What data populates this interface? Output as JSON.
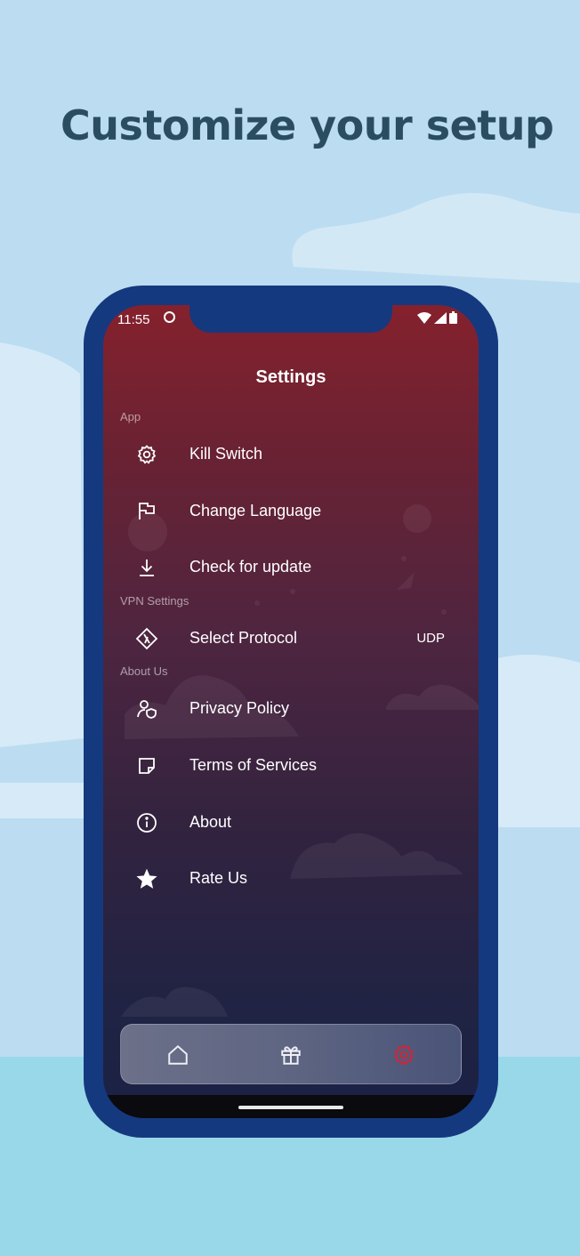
{
  "headline": "Customize your setup",
  "status_bar": {
    "time": "11:55"
  },
  "screen": {
    "title": "Settings",
    "sections": {
      "app": "App",
      "vpn": "VPN Settings",
      "about": "About Us"
    },
    "items": {
      "kill_switch": "Kill Switch",
      "change_language": "Change Language",
      "check_update": "Check for update",
      "select_protocol": "Select Protocol",
      "protocol_value": "UDP",
      "privacy_policy": "Privacy Policy",
      "terms": "Terms of Services",
      "about": "About",
      "rate_us": "Rate Us"
    },
    "icons": {
      "kill_switch": "gear-icon",
      "change_language": "flag-icon",
      "check_update": "download-icon",
      "select_protocol": "protocol-icon",
      "privacy_policy": "user-shield-icon",
      "terms": "note-icon",
      "about": "info-icon",
      "rate_us": "star-icon"
    }
  },
  "bottom_nav": {
    "items": [
      "home-icon",
      "gift-icon",
      "settings-icon"
    ],
    "active": "settings-icon",
    "active_color": "#c8283c"
  },
  "colors": {
    "phone_frame": "#15397e",
    "headline": "#2a4e60",
    "background": "#bcdcf1"
  }
}
